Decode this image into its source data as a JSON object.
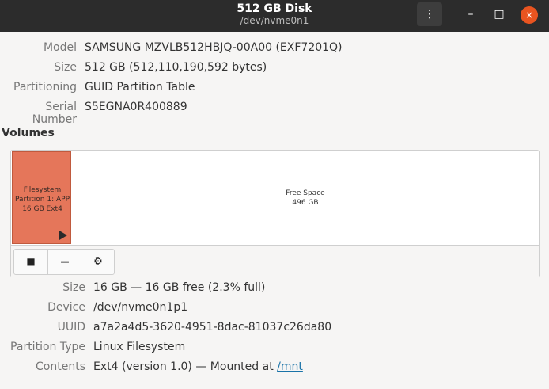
{
  "window": {
    "title": "512 GB Disk",
    "subtitle": "/dev/nvme0n1",
    "menu_icon": "⋮",
    "minimize_icon": "–",
    "maximize_icon": "□",
    "close_icon": "×"
  },
  "disk": {
    "model_label": "Model",
    "model_value": "SAMSUNG MZVLB512HBJQ-00A00 (EXF7201Q)",
    "size_label": "Size",
    "size_value": "512 GB (512,110,190,592 bytes)",
    "partitioning_label": "Partitioning",
    "partitioning_value": "GUID Partition Table",
    "serial_label": "Serial Number",
    "serial_value": "S5EGNA0R400889"
  },
  "volumes": {
    "heading": "Volumes",
    "partition": {
      "line1": "Filesystem",
      "line2": "Partition 1: APP",
      "line3": "16 GB Ext4"
    },
    "free": {
      "line1": "Free Space",
      "line2": "496 GB"
    },
    "toolbar": {
      "stop_icon": "■",
      "minus_icon": "—",
      "settings_icon": "⚙"
    }
  },
  "partition_details": {
    "size_label": "Size",
    "size_value": "16 GB — 16 GB free (2.3% full)",
    "device_label": "Device",
    "device_value": "/dev/nvme0n1p1",
    "uuid_label": "UUID",
    "uuid_value": "a7a2a4d5-3620-4951-8dac-81037c26da80",
    "type_label": "Partition Type",
    "type_value": "Linux Filesystem",
    "contents_label": "Contents",
    "contents_prefix": "Ext4 (version 1.0) — Mounted at ",
    "contents_link": "/mnt"
  }
}
